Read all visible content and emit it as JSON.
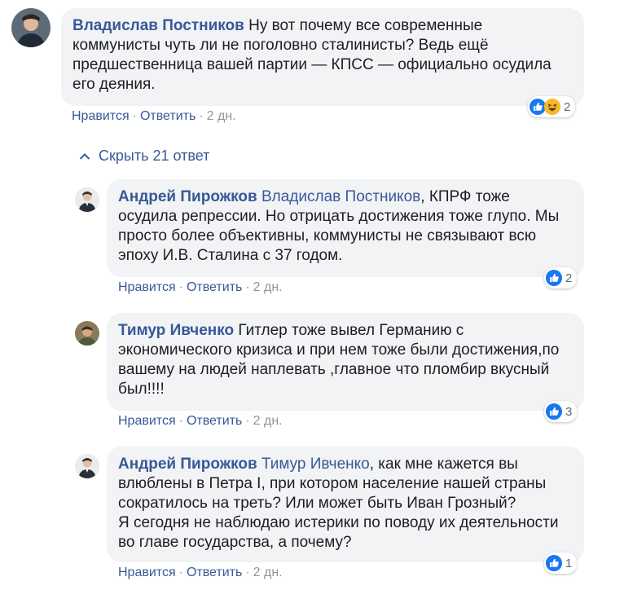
{
  "thread": {
    "top": {
      "author": "Владислав Постников",
      "text": "Ну вот почему все современные коммунисты чуть ли не поголовно сталинисты? Ведь ещё предшественница вашей партии — КПСС — официально осудила его деяния.",
      "actions": {
        "like": "Нравится",
        "reply": "Ответить",
        "time": "2 дн."
      },
      "reactions": {
        "icons": [
          "like-icon",
          "haha-icon"
        ],
        "count": "2"
      }
    },
    "hide_replies": "Скрыть 21 ответ",
    "replies": [
      {
        "author": "Андрей Пирожков",
        "mention": "Владислав Постников",
        "text": ", КПРФ тоже осудила репрессии. Но отрицать достижения тоже глупо. Мы просто более объективны, коммунисты не связывают всю эпоху И.В. Сталина с 37 годом.",
        "actions": {
          "like": "Нравится",
          "reply": "Ответить",
          "time": "2 дн."
        },
        "reactions": {
          "icons": [
            "like-icon"
          ],
          "count": "2"
        }
      },
      {
        "author": "Тимур Ивченко",
        "text": "Гитлер тоже вывел Германию с экономического кризиса и при нем тоже были достижения,по вашему на людей наплевать ,главное что пломбир вкусный был!!!!",
        "actions": {
          "like": "Нравится",
          "reply": "Ответить",
          "time": "2 дн."
        },
        "reactions": {
          "icons": [
            "like-icon"
          ],
          "count": "3"
        }
      },
      {
        "author": "Андрей Пирожков",
        "mention": "Тимур Ивченко",
        "text": ", как мне кажется вы влюблены в Петра I, при котором население нашей страны сократилось на треть? Или может быть Иван Грозный?",
        "text2": "Я сегодня не наблюдаю истерики по поводу их деятельности во главе государства, а почему?",
        "actions": {
          "like": "Нравится",
          "reply": "Ответить",
          "time": "2 дн."
        },
        "reactions": {
          "icons": [
            "like-icon"
          ],
          "count": "1"
        }
      }
    ]
  },
  "colors": {
    "link": "#385898",
    "bubble": "#f2f3f5",
    "like": "#1877f2",
    "haha": "#f7b928"
  }
}
